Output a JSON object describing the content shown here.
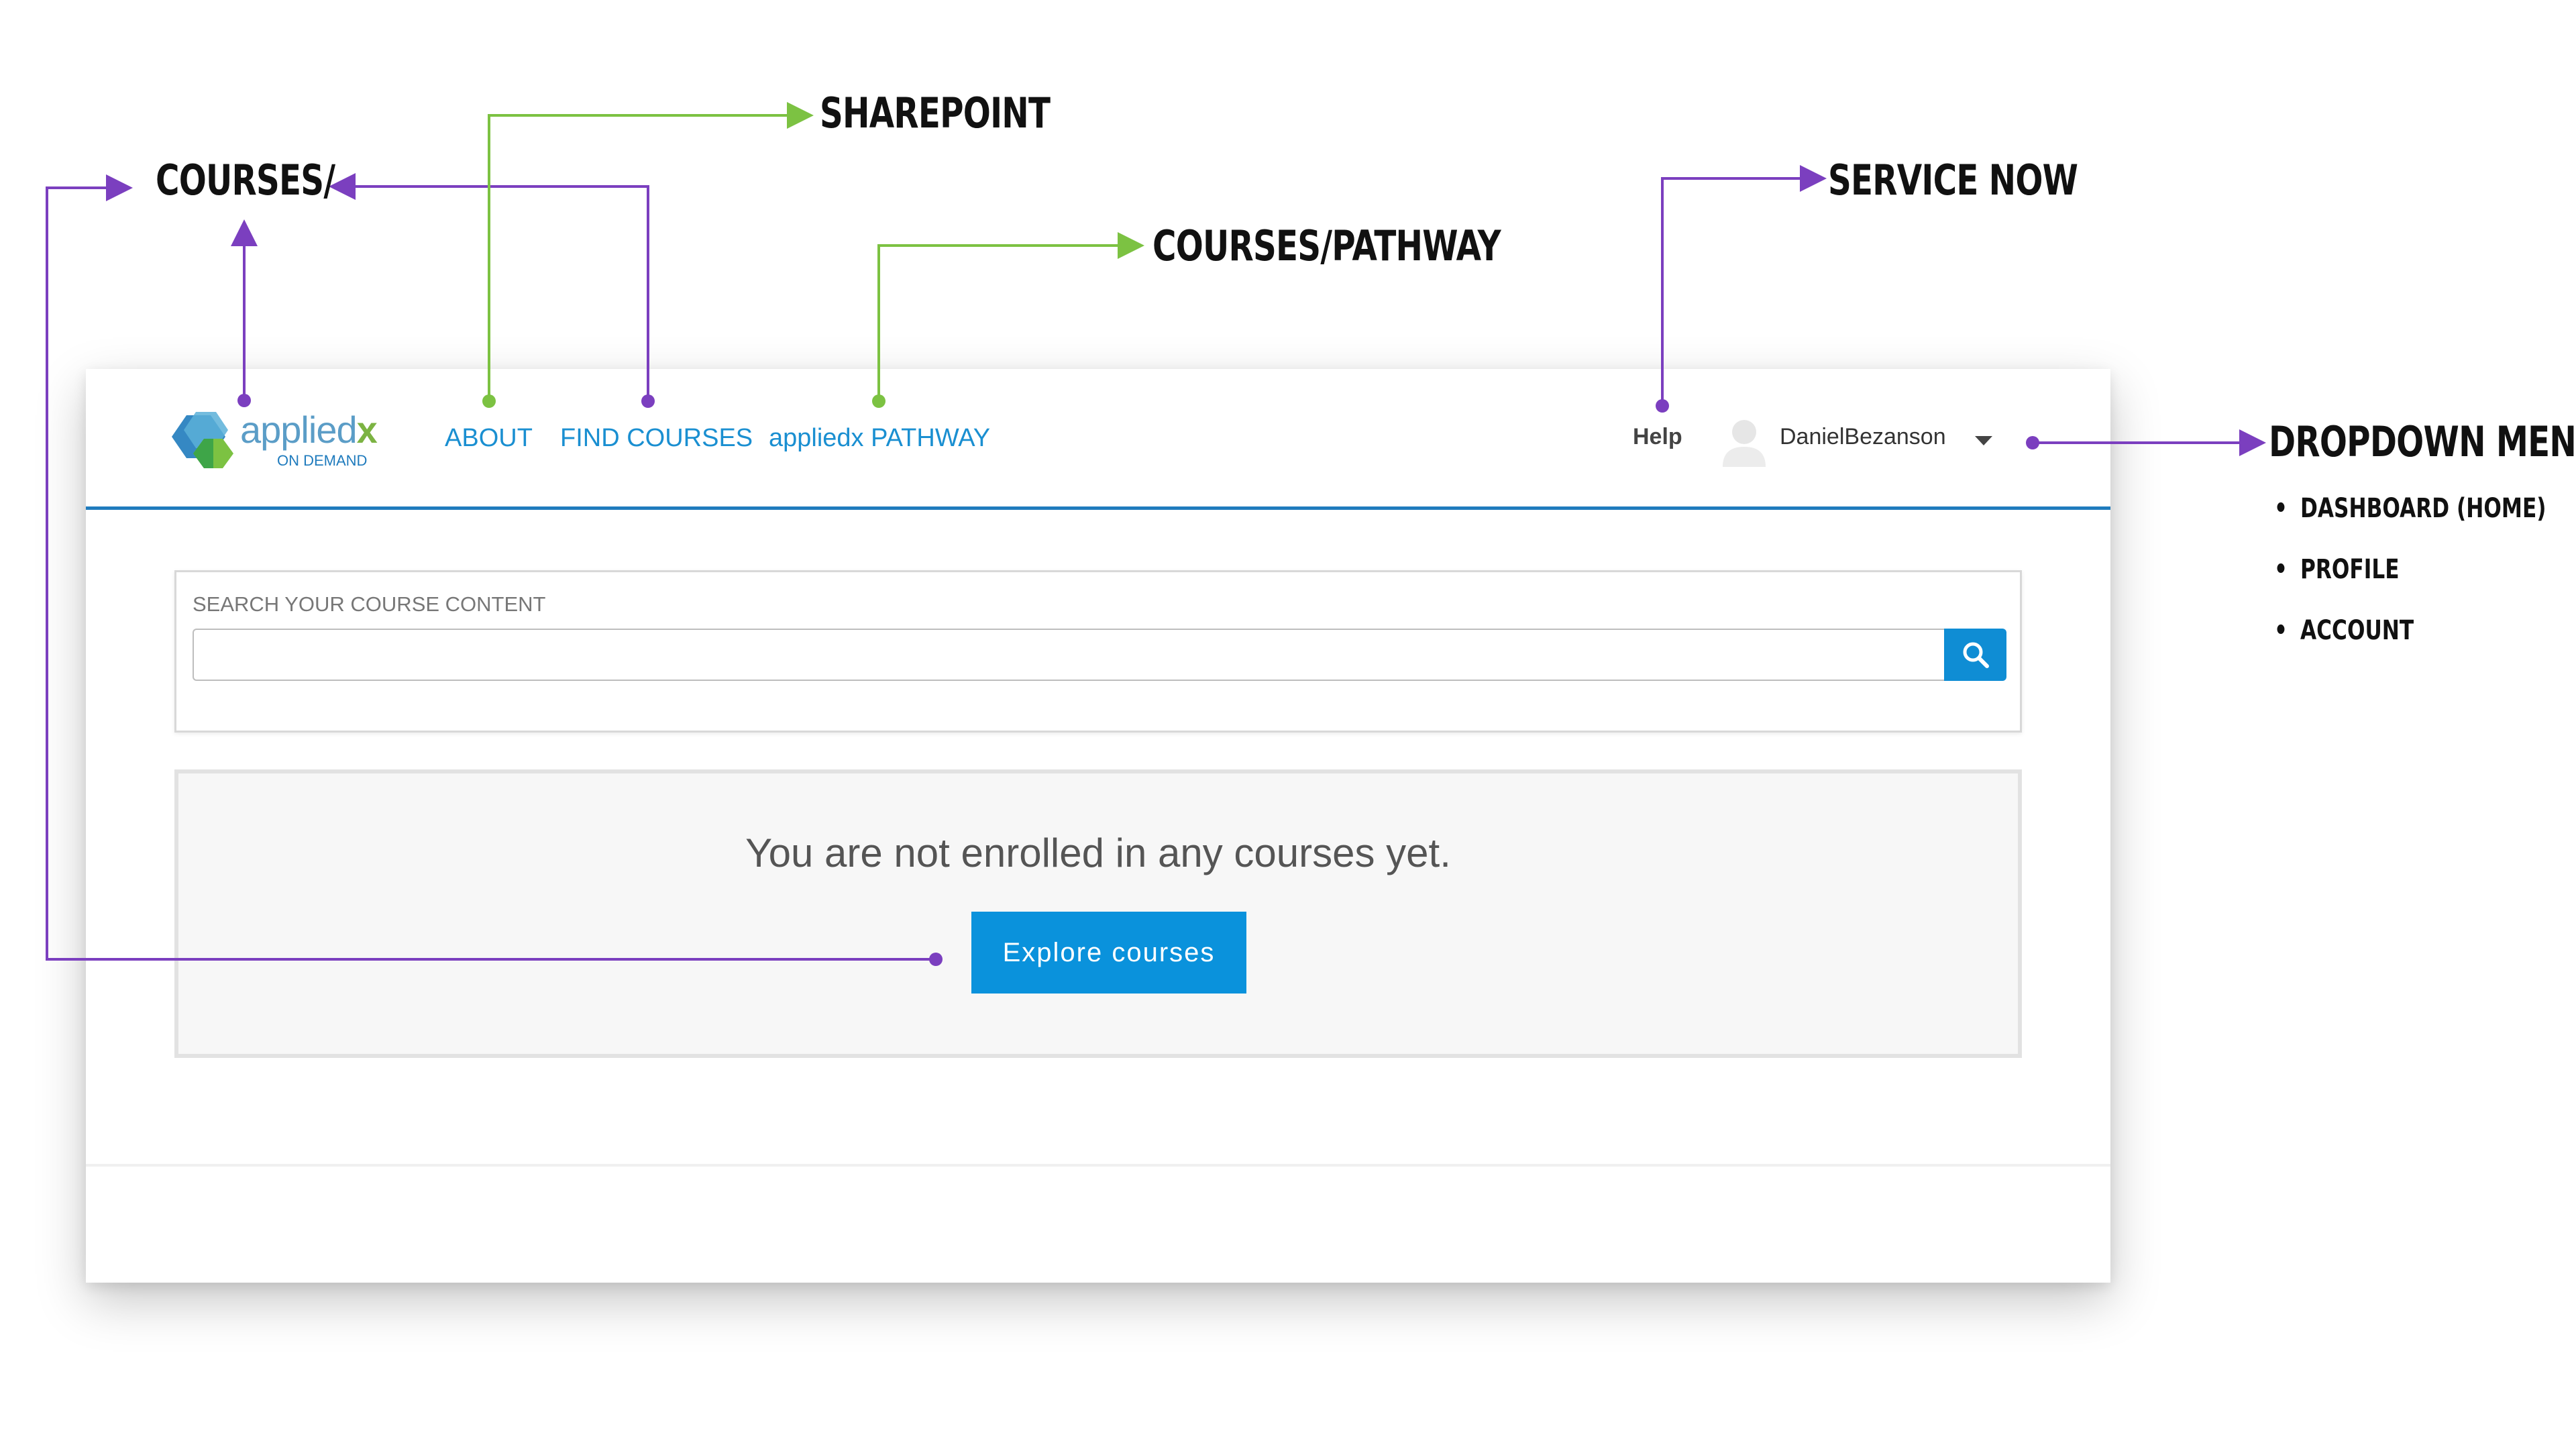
{
  "header": {
    "logo_text": "applied",
    "logo_text_x": "x",
    "logo_subtitle": "ON DEMAND",
    "nav": [
      {
        "label": "ABOUT"
      },
      {
        "label": "FIND COURSES"
      },
      {
        "label": "appliedx PATHWAY"
      }
    ],
    "help_label": "Help",
    "username": "DanielBezanson"
  },
  "search": {
    "label": "SEARCH YOUR COURSE CONTENT",
    "value": "",
    "placeholder": ""
  },
  "empty_state": {
    "message": "You are not enrolled in any courses yet.",
    "button_label": "Explore courses"
  },
  "annotations": {
    "courses": "COURSES/",
    "sharepoint": "SHAREPOINT",
    "courses_pathway": "COURSES/PATHWAY",
    "service_now": "SERVICE NOW",
    "dropdown_menu": "DROPDOWN MENU",
    "dropdown_items": [
      "DASHBOARD (HOME)",
      "PROFILE",
      "ACCOUNT"
    ]
  },
  "colors": {
    "accent_blue": "#0a92dc",
    "header_rule": "#1f7bbd",
    "annotation_purple": "#7b3fbf",
    "annotation_green": "#7cc242"
  }
}
